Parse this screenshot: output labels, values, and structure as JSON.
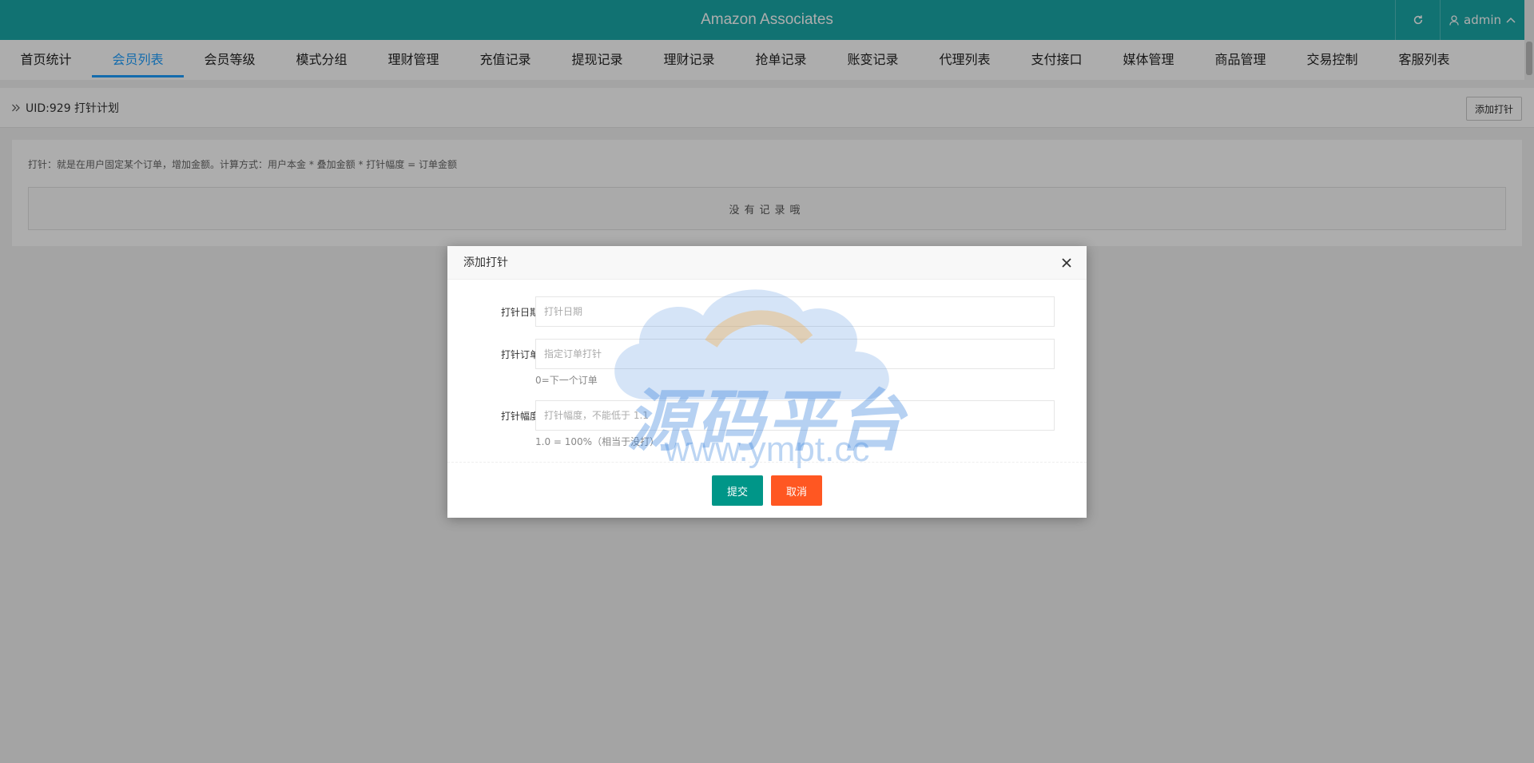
{
  "header": {
    "title": "Amazon Associates",
    "user": "admin"
  },
  "nav": {
    "items": [
      {
        "label": "首页统计",
        "active": false
      },
      {
        "label": "会员列表",
        "active": true
      },
      {
        "label": "会员等级",
        "active": false
      },
      {
        "label": "模式分组",
        "active": false
      },
      {
        "label": "理财管理",
        "active": false
      },
      {
        "label": "充值记录",
        "active": false
      },
      {
        "label": "提现记录",
        "active": false
      },
      {
        "label": "理财记录",
        "active": false
      },
      {
        "label": "抢单记录",
        "active": false
      },
      {
        "label": "账变记录",
        "active": false
      },
      {
        "label": "代理列表",
        "active": false
      },
      {
        "label": "支付接口",
        "active": false
      },
      {
        "label": "媒体管理",
        "active": false
      },
      {
        "label": "商品管理",
        "active": false
      },
      {
        "label": "交易控制",
        "active": false
      },
      {
        "label": "客服列表",
        "active": false
      }
    ]
  },
  "subbar": {
    "breadcrumb": "UID:929 打针计划",
    "add_button": "添加打针"
  },
  "main": {
    "hint": "打针：就是在用户固定某个订单，增加金额。计算方式：用户本金 * 叠加金额 * 打针幅度 = 订单金额",
    "empty_text": "没有记录哦"
  },
  "modal": {
    "title": "添加打针",
    "fields": {
      "date": {
        "label": "打针日期",
        "placeholder": "打针日期",
        "value": ""
      },
      "order": {
        "label": "打针订单",
        "placeholder": "指定订单打针",
        "value": "",
        "help": "0=下一个订单"
      },
      "ratio": {
        "label": "打针幅度",
        "placeholder": "打针幅度，不能低于 1.1",
        "value": "",
        "help": "1.0 = 100%（相当于没打）"
      }
    },
    "submit": "提交",
    "cancel": "取消"
  },
  "watermark": {
    "cn": "源码平台",
    "url": "www.ympt.cc"
  },
  "colors": {
    "header": "#1aa8a8",
    "nav_active": "#1e9fff",
    "submit": "#009688",
    "cancel": "#ff5722"
  }
}
